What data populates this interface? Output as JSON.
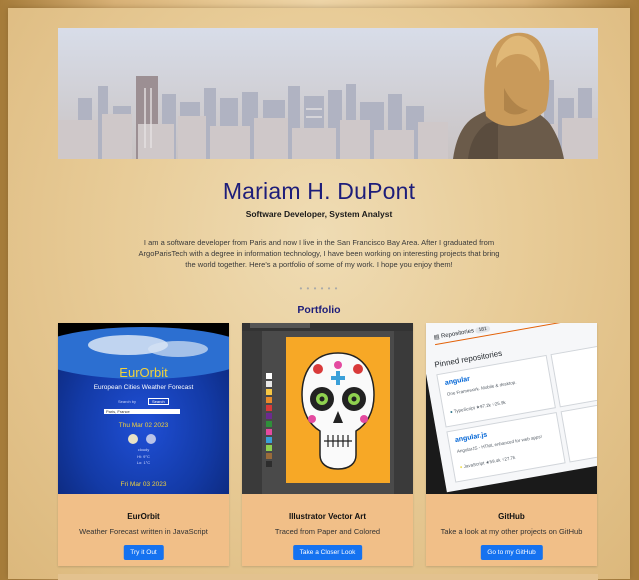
{
  "profile": {
    "name": "Mariam H. DuPont",
    "subtitle": "Software Developer, System Analyst",
    "bio": "I am a software developer from Paris and now I live in the San Francisco Bay Area. After I graduated from ArgoParisTech with a degree in information technology, I have been working on interesting projects that bring the world together. Here's a portfolio of some of my work. I hope you enjoy them!",
    "divider": "• • • • • •"
  },
  "portfolio": {
    "heading": "Portfolio",
    "cards": [
      {
        "title": "EurOrbit",
        "description": "Weather Forecast written in JavaScript",
        "button": "Try it Out",
        "preview": {
          "app_title": "EurOrbit",
          "app_subtitle": "European Cities Weather Forecast",
          "search_label": "Search by",
          "search_button": "Search",
          "search_value": "Paris, France",
          "date1": "Thu Mar 02 2023",
          "condition": "cloudy",
          "temp_hi": "Hi: 9°C",
          "temp_lo": "Lo: 1°C",
          "date2": "Fri Mar 03 2023"
        }
      },
      {
        "title": "Illustrator Vector Art",
        "description": "Traced from Paper and Colored",
        "button": "Take a Closer Look"
      },
      {
        "title": "GitHub",
        "description": "Take a look at my other projects on GitHub",
        "button": "Go to my GitHub",
        "preview": {
          "tab_repos": "Repositories",
          "repo_count": "181",
          "pinned": "Pinned repositories",
          "repo1": "angular",
          "repo1_desc": "One Framework. Mobile & desktop.",
          "repo1_lang": "TypeScript",
          "repo1_stars": "97.2k",
          "repo1_forks": "25.9k",
          "repo2": "angular.js",
          "repo2_desc": "AngularJS - HTML enhanced for web apps!",
          "repo2_lang": "JavaScript",
          "repo2_stars": "59.4k",
          "repo2_forks": "27.7k"
        }
      }
    ]
  },
  "colors": {
    "name": "#1d1d7a",
    "card": "#f1bf88",
    "button": "#1572f0"
  }
}
